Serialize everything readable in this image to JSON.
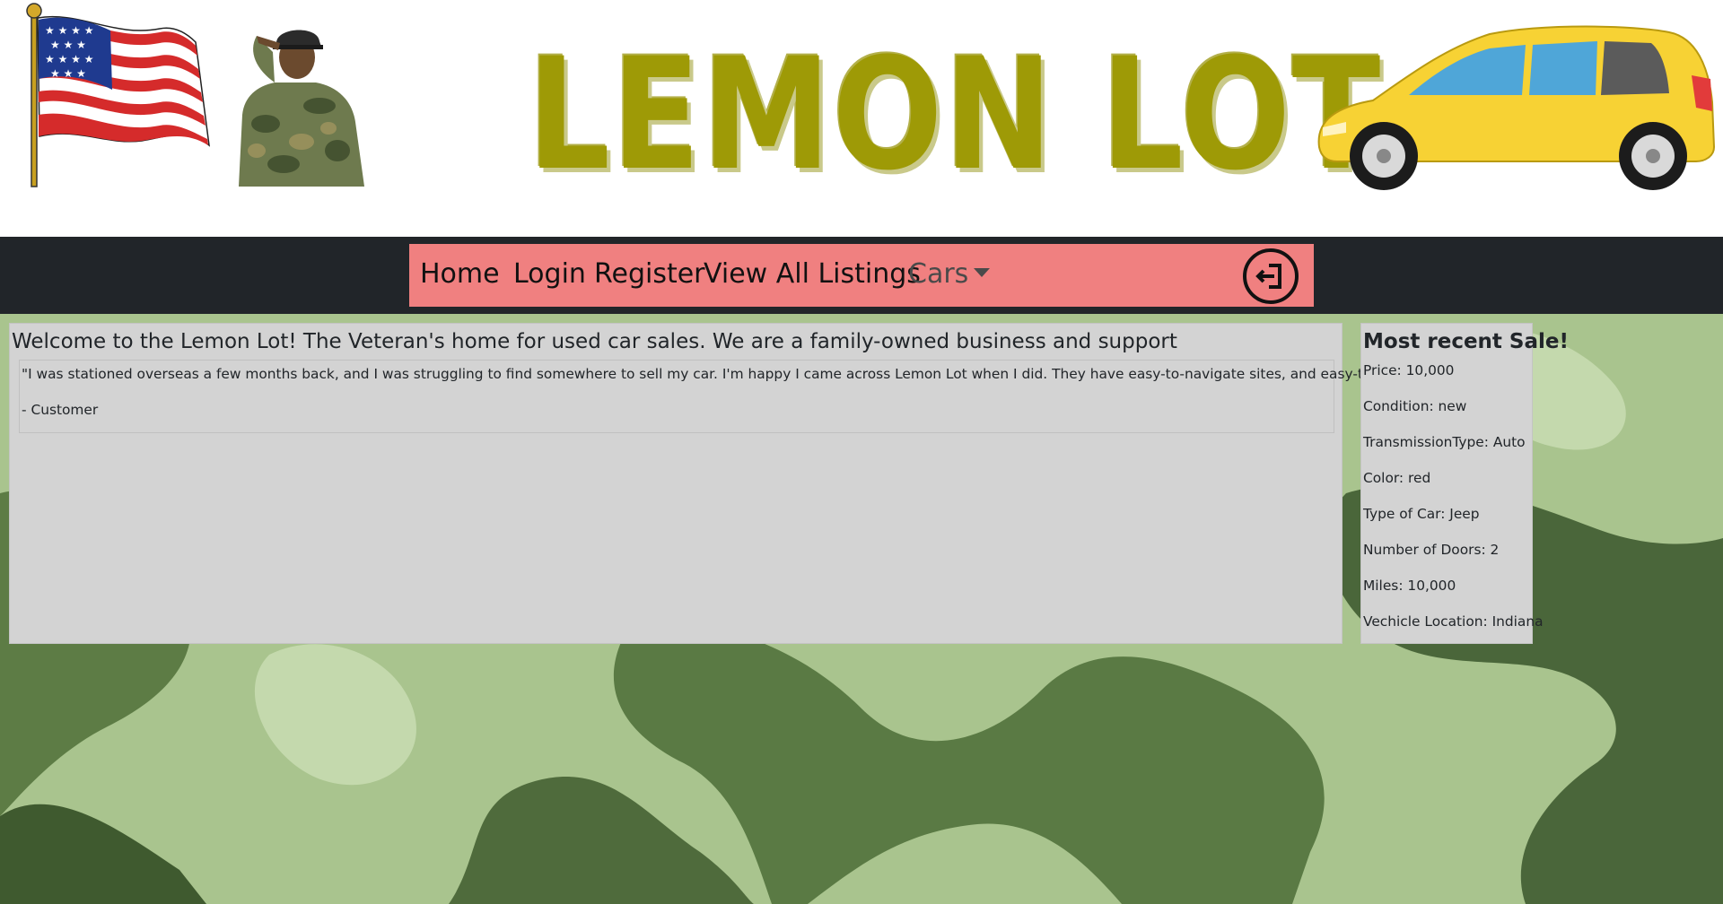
{
  "header": {
    "logo_text": "LEMON LOT",
    "flag_icon": "us-flag-icon",
    "soldier_icon": "saluting-soldier-image",
    "car_icon": "yellow-car-image"
  },
  "nav": {
    "items": [
      {
        "label": "Home"
      },
      {
        "label": "Login"
      },
      {
        "label": "Register"
      },
      {
        "label": "View All Listings"
      },
      {
        "label": "Cars"
      }
    ],
    "logout_icon": "logout-icon",
    "bar_color": "#f08080",
    "strip_color": "#212529"
  },
  "main": {
    "welcome": "Welcome to the Lemon Lot! The Veteran's home for used car sales. We are a family-owned business and support",
    "testimonial": {
      "quote": "\"I was stationed overseas a few months back, and I was struggling to find somewhere to sell my car. I'm happy I came across Lemon Lot when I did. They have easy-to-navigate sites, and easy-to-use features.\"",
      "author": "- Customer"
    }
  },
  "recent_sale": {
    "title": "Most recent Sale!",
    "specs": [
      "Price: 10,000",
      "Condition: new",
      "TransmissionType: Auto",
      "Color: red",
      "Type of Car: Jeep",
      "Number of Doors: 2",
      "Miles: 10,000",
      "Vechicle Location: Indiana"
    ]
  },
  "colors": {
    "panel": "#d3d3d3",
    "logo": "#9e9a06",
    "camo_light": "#a9c48e",
    "camo_dark": "#4f6b3c"
  }
}
